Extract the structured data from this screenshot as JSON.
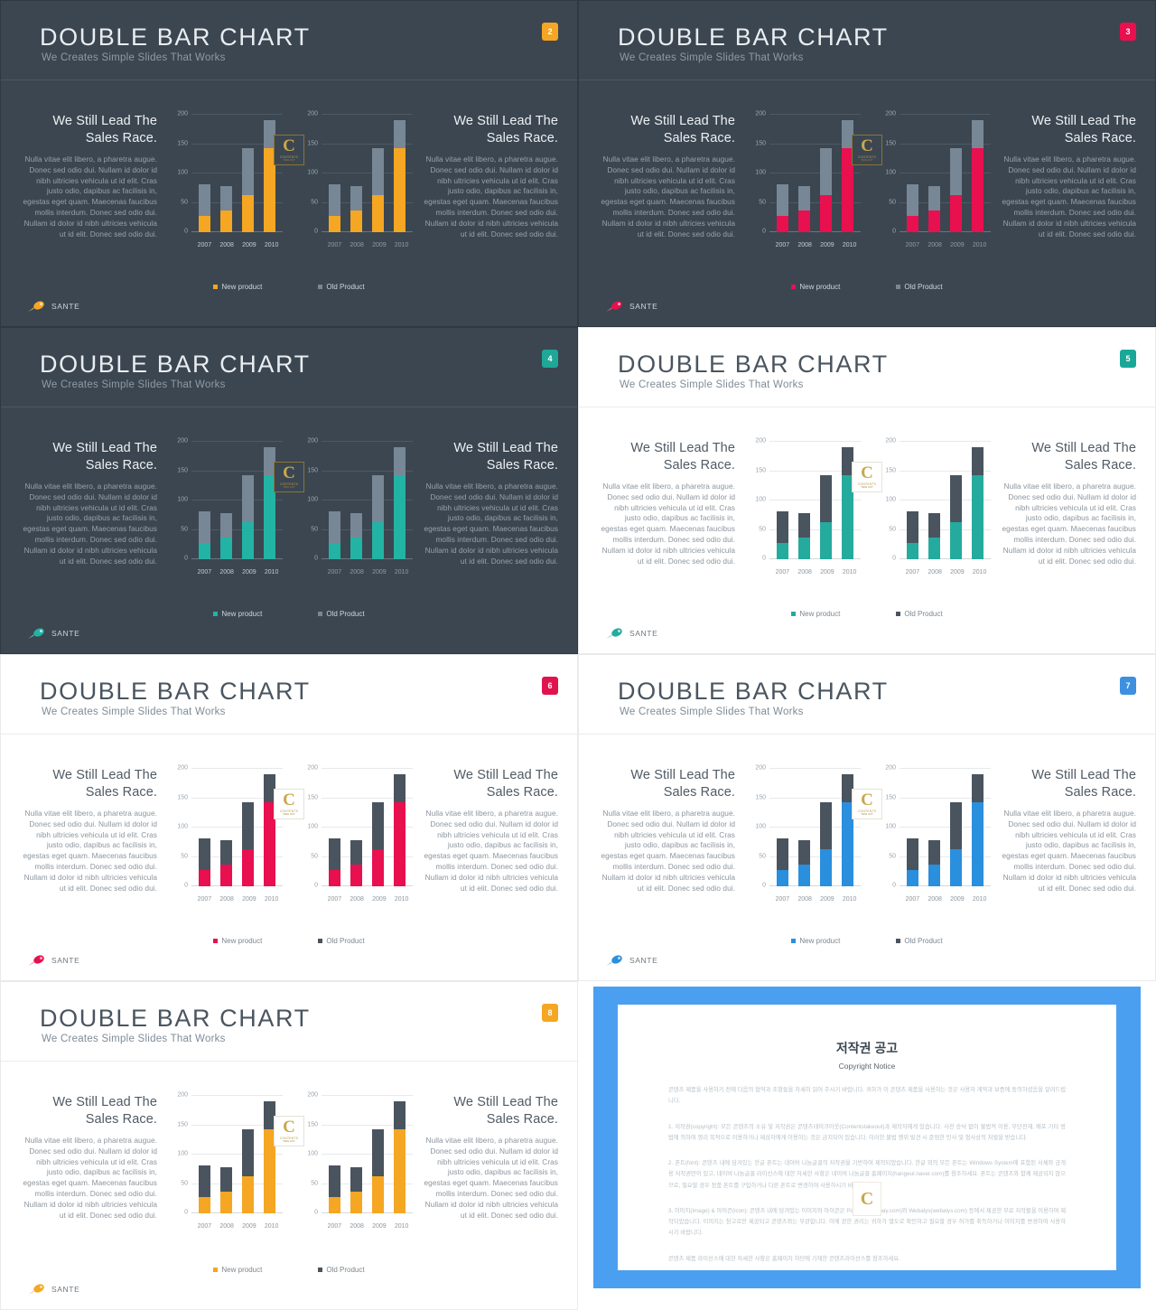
{
  "deck": {
    "title": "DOUBLE BAR CHART",
    "subtitle": "We Creates Simple Slides That Works",
    "heading": "We Still Lead The Sales Race.",
    "paragraph": "Nulla vitae elit libero, a pharetra augue. Donec sed odio dui. Nullam id dolor id nibh ultricies vehicula ut id elit. Cras justo odio, dapibus ac facilisis in, egestas eget quam. Maecenas faucibus mollis interdum. Donec sed odio dui. Nullam id dolor id nibh ultricies vehicula ut id elit. Donec sed odio dui.",
    "brand_name": "SANTE",
    "watermark": {
      "letter": "C",
      "line1": "CONTENTS",
      "line2": "TAKE OUT"
    }
  },
  "legend": {
    "new_label": "New product",
    "old_label": "Old Product"
  },
  "slides": [
    {
      "number": "2",
      "theme": "dark",
      "accent": "#f5a623",
      "badge_bg": "#f5a623"
    },
    {
      "number": "3",
      "theme": "dark",
      "accent": "#e8104e",
      "badge_bg": "#e8104e"
    },
    {
      "number": "4",
      "theme": "dark",
      "accent": "#23b3a4",
      "badge_bg": "#1fa898"
    },
    {
      "number": "5",
      "theme": "light",
      "accent": "#24ab9d",
      "badge_bg": "#1aa798"
    },
    {
      "number": "6",
      "theme": "light",
      "accent": "#e8104e",
      "badge_bg": "#e0134f"
    },
    {
      "number": "7",
      "theme": "light",
      "accent": "#2a8fdd",
      "badge_bg": "#3d8fe0"
    },
    {
      "number": "8",
      "theme": "light",
      "accent": "#f5a623",
      "badge_bg": "#f5a623"
    }
  ],
  "chart_data": {
    "type": "bar",
    "title": "DOUBLE BAR CHART",
    "subtype": "stacked",
    "categories": [
      "2007",
      "2008",
      "2009",
      "2010"
    ],
    "series": [
      {
        "name": "New product",
        "values": [
          28,
          37,
          63,
          143
        ]
      },
      {
        "name": "Old Product",
        "values": [
          54,
          42,
          80,
          48
        ]
      }
    ],
    "totals": [
      82,
      79,
      143,
      191
    ],
    "yticks": [
      "0",
      "50",
      "100",
      "150",
      "200"
    ],
    "ylim": [
      0,
      200
    ],
    "xlabel": "",
    "ylabel": "",
    "grid": true,
    "legend_position": "bottom",
    "panels": 2
  },
  "copyright": {
    "title": "저작권 공고",
    "subtitle": "Copyright Notice",
    "intro": "콘텐츠 제품을 사용하기 전에 다음의 협약과 조항들을 자세히 읽어 주시기 바랍니다. 귀하가 이 콘텐츠 제품을 사용하는 것은 사용자 계약과 보증에 동의하셨음을 알려드립니다.",
    "p1": "1. 저작권(copyright): 모든 콘텐츠의 소유 및 저작권은 콘텐츠테이크아웃(Contentstakeout)과 제작자에게 있습니다. 사전 승낙 없이 불법적 이용, 무단전재, 배포 기타 방법에 의하여 영리 목적으로 이용하거나 제삼자에게 이용하는 것은 금지되어 있습니다. 이러한 불법 행위 발견 시 준엄한 민사 및 형사상의 처벌을 받습니다.",
    "p2": "2. 폰트(font): 콘텐츠 내에 담겨있는 한글 폰트는 네이버 나눔글꼴의 저작권을 기반하여 제작되었습니다. 한글 외의 모든 폰트는 Windows System에 포함된 서체와 공개용 저작권만이 있고, 네이버 나눔글꼴 라이선스에 대한 자세한 사항은 네이버 나눔글꼴 홈페이지(hangeul.naver.com)를 참조하세요. 폰트는 콘텐츠와 함께 제공되지 않으므로, 필요할 경우 정품 폰트를 구입하거나 다른 폰트로 변경하여 사용하시기 바랍니다.",
    "p3": "3. 이미지(image) & 아이콘(icon): 콘텐츠 내에 담겨있는 이미지와 아이콘은 Pixabay(pixabay.com)와 Webalys(webalys.com) 등에서 제공한 무료 저작물을 이용하여 제작되었습니다. 이미지는 참고로만 제공되고 콘텐츠와는 무관합니다. 이에 관한 권리는 귀하가 별도로 확인하고 필요할 경우 허가를 취득하거나 이미지를 변경하여 사용하시기 바랍니다.",
    "p4": "콘텐츠 제품 라이선스에 대한 자세한 사항은 홈페이지 하단에 기재한 콘텐츠라이선스를 참조하세요.",
    "border_color": "#4a9ff0"
  }
}
